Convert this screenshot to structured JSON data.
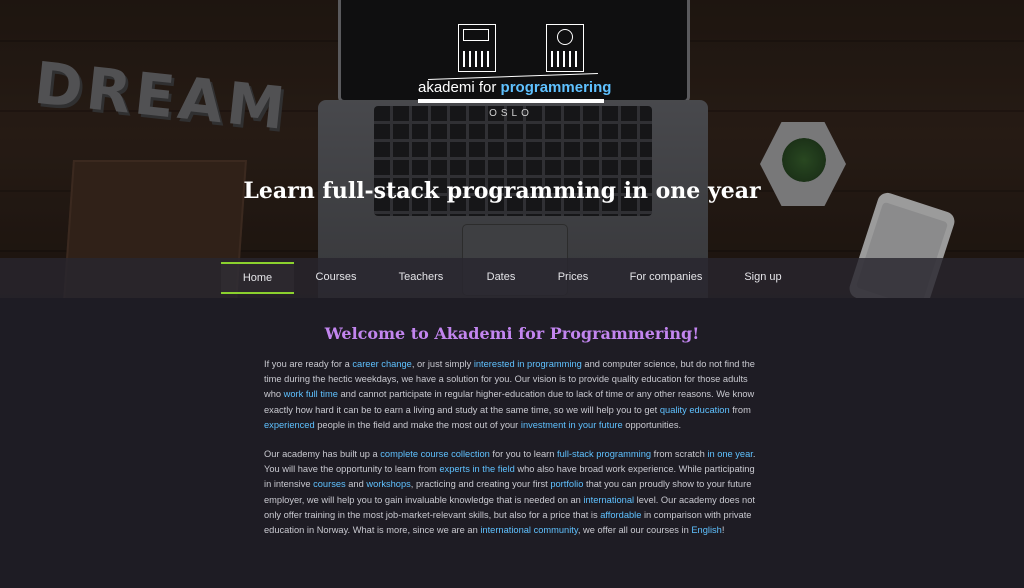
{
  "logo": {
    "prefix": "akademi for ",
    "bold": "programmering",
    "city": "OSLO"
  },
  "hero": {
    "dream_text": "DREAM",
    "title": "Learn full-stack programming in one year"
  },
  "nav": {
    "items": [
      {
        "label": "Home",
        "active": true
      },
      {
        "label": "Courses"
      },
      {
        "label": "Teachers"
      },
      {
        "label": "Dates"
      },
      {
        "label": "Prices"
      },
      {
        "label": "For companies"
      },
      {
        "label": "Sign up"
      }
    ]
  },
  "main": {
    "heading": "Welcome to Akademi for Programmering!",
    "p1": [
      {
        "t": "If you are ready for a "
      },
      {
        "t": "career change",
        "link": true
      },
      {
        "t": ", or just simply "
      },
      {
        "t": "interested in programming",
        "link": true
      },
      {
        "t": " and computer science, but do not find the time during the hectic weekdays, we have a solution for you. Our vision is to provide quality education for those adults who "
      },
      {
        "t": "work full time",
        "link": true
      },
      {
        "t": " and cannot participate in regular higher-education due to lack of time or any other reasons. We know exactly how hard it can be to earn a living and study at the same time, so we will help you to get "
      },
      {
        "t": "quality education",
        "link": true
      },
      {
        "t": " from "
      },
      {
        "t": "experienced",
        "link": true
      },
      {
        "t": " people in the field and make the most out of your "
      },
      {
        "t": "investment in your future",
        "link": true
      },
      {
        "t": " opportunities."
      }
    ],
    "p2": [
      {
        "t": "Our academy has built up a "
      },
      {
        "t": "complete course collection",
        "link": true
      },
      {
        "t": " for you to learn "
      },
      {
        "t": "full-stack programming",
        "link": true
      },
      {
        "t": " from scratch "
      },
      {
        "t": "in one year",
        "link": true
      },
      {
        "t": ". You will have the opportunity to learn from "
      },
      {
        "t": "experts in the field",
        "link": true
      },
      {
        "t": " who also have broad work experience. While participating in intensive "
      },
      {
        "t": "courses",
        "link": true
      },
      {
        "t": " and "
      },
      {
        "t": "workshops",
        "link": true
      },
      {
        "t": ", practicing and creating your first "
      },
      {
        "t": "portfolio",
        "link": true
      },
      {
        "t": " that you can proudly show to your future employer, we will help you to gain invaluable knowledge that is needed on an "
      },
      {
        "t": "international",
        "link": true
      },
      {
        "t": " level. Our academy does not only offer training in the most job-market-relevant skills, but also for a price that is "
      },
      {
        "t": "affordable",
        "link": true
      },
      {
        "t": " in comparison with private education in Norway. What is more, since we are an "
      },
      {
        "t": "international community",
        "link": true
      },
      {
        "t": ", we offer all our courses in "
      },
      {
        "t": "English",
        "link": true
      },
      {
        "t": "!"
      }
    ]
  },
  "colors": {
    "accent_green": "#8bd12e",
    "link_blue": "#5fc1ff",
    "heading_purple": "#c285ef",
    "background": "#1e1c24"
  }
}
